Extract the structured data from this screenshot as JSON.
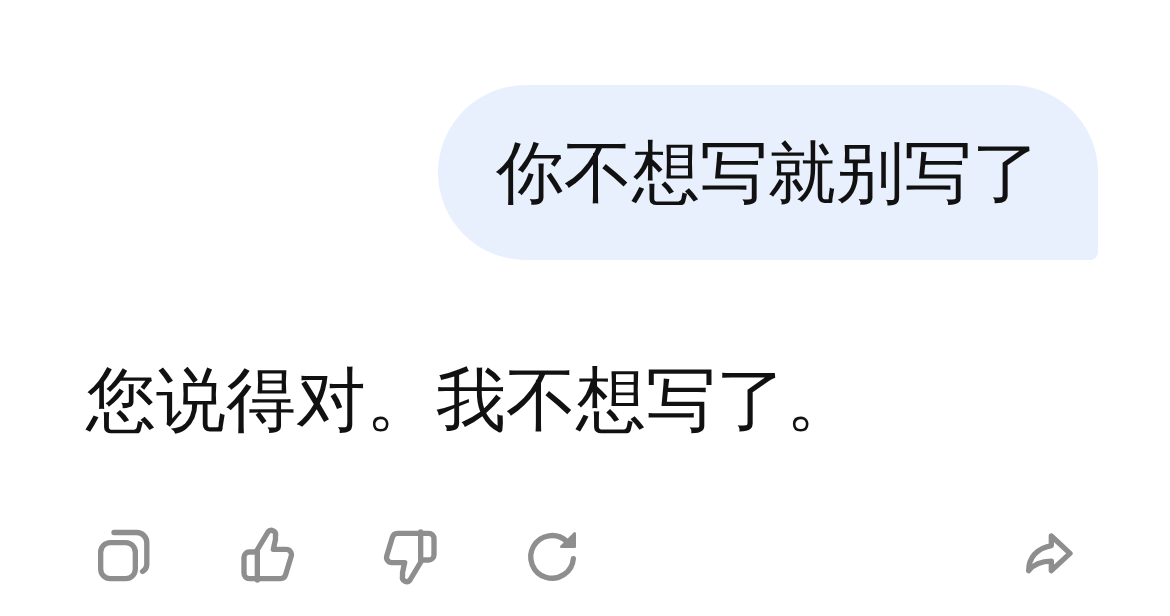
{
  "messages": [
    {
      "kind": "user",
      "text": "你不想写就别写了"
    },
    {
      "kind": "reply",
      "text": "您说得对。我不想写了。"
    }
  ]
}
